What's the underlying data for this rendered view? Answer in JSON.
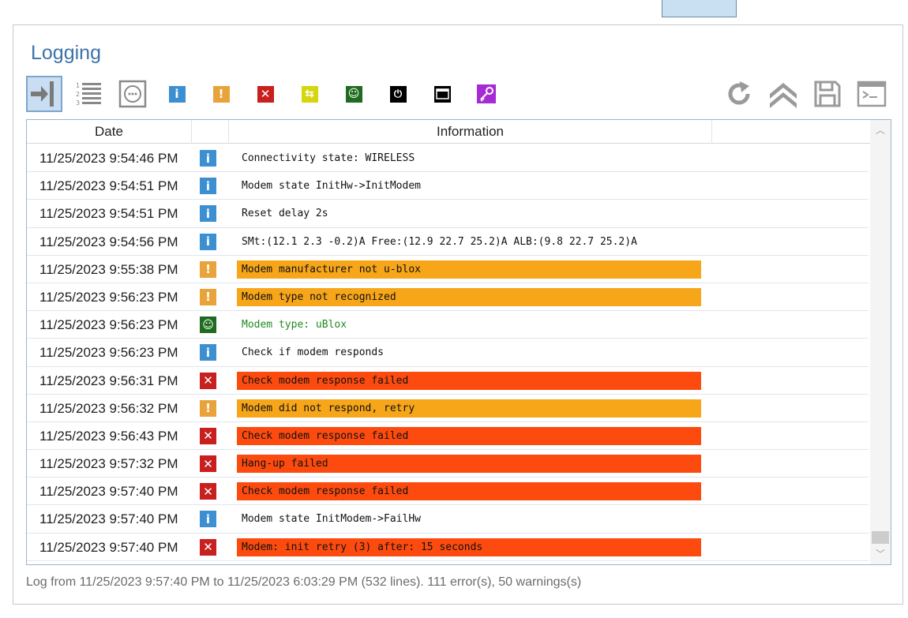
{
  "title": "Logging",
  "toolbar": {
    "left": [
      {
        "name": "follow-tail-button",
        "icon": "arrow-to-line-icon",
        "active": true
      },
      {
        "name": "line-numbers-button",
        "icon": "numbered-list-icon"
      },
      {
        "name": "filter-all-button",
        "icon": "circle-dots-icon"
      },
      {
        "name": "filter-info-button",
        "icon": "info-icon",
        "color": "#3c8fd0"
      },
      {
        "name": "filter-warning-button",
        "icon": "warning-icon",
        "color": "#e8a43a"
      },
      {
        "name": "filter-error-button",
        "icon": "error-icon",
        "color": "#c81f1f"
      },
      {
        "name": "filter-transfer-button",
        "icon": "exchange-icon",
        "color": "#d6d60e"
      },
      {
        "name": "filter-ok-button",
        "icon": "smiley-icon",
        "color": "#1f6b1f"
      },
      {
        "name": "filter-power-button",
        "icon": "power-icon",
        "color": "#000000"
      },
      {
        "name": "filter-terminal-button",
        "icon": "terminal-icon",
        "color": "#000000"
      },
      {
        "name": "filter-key-button",
        "icon": "key-icon",
        "color": "#a62bd6"
      }
    ],
    "right": [
      {
        "name": "refresh-button",
        "icon": "refresh-icon"
      },
      {
        "name": "scroll-top-button",
        "icon": "double-chevron-up-icon"
      },
      {
        "name": "save-button",
        "icon": "save-icon"
      },
      {
        "name": "console-button",
        "icon": "console-icon"
      }
    ]
  },
  "table": {
    "columns": [
      "Date",
      "Information"
    ],
    "rows": [
      {
        "date": "11/25/2023 9:54:46 PM",
        "type": "info",
        "message": "Connectivity state: WIRELESS"
      },
      {
        "date": "11/25/2023 9:54:51 PM",
        "type": "info",
        "message": "Modem state InitHw->InitModem"
      },
      {
        "date": "11/25/2023 9:54:51 PM",
        "type": "info",
        "message": "Reset delay 2s"
      },
      {
        "date": "11/25/2023 9:54:56 PM",
        "type": "info",
        "message": "SMt:(12.1 2.3 -0.2)A Free:(12.9 22.7 25.2)A ALB:(9.8 22.7 25.2)A"
      },
      {
        "date": "11/25/2023 9:55:38 PM",
        "type": "warning",
        "message": "Modem manufacturer not u-blox"
      },
      {
        "date": "11/25/2023 9:56:23 PM",
        "type": "warning",
        "message": "Modem type not recognized"
      },
      {
        "date": "11/25/2023 9:56:23 PM",
        "type": "ok",
        "message": "Modem type: uBlox"
      },
      {
        "date": "11/25/2023 9:56:23 PM",
        "type": "info",
        "message": "Check if modem responds"
      },
      {
        "date": "11/25/2023 9:56:31 PM",
        "type": "error",
        "message": "Check modem response failed"
      },
      {
        "date": "11/25/2023 9:56:32 PM",
        "type": "warning",
        "message": "Modem did not respond, retry"
      },
      {
        "date": "11/25/2023 9:56:43 PM",
        "type": "error",
        "message": "Check modem response failed"
      },
      {
        "date": "11/25/2023 9:57:32 PM",
        "type": "error",
        "message": "Hang-up failed"
      },
      {
        "date": "11/25/2023 9:57:40 PM",
        "type": "error",
        "message": "Check modem response failed"
      },
      {
        "date": "11/25/2023 9:57:40 PM",
        "type": "info",
        "message": "Modem state InitModem->FailHw"
      },
      {
        "date": "11/25/2023 9:57:40 PM",
        "type": "error",
        "message": "Modem: init retry (3) after: 15 seconds"
      }
    ]
  },
  "footer": "Log from 11/25/2023 9:57:40 PM to 11/25/2023 6:03:29 PM (532 lines). 111 error(s), 50 warnings(s)",
  "colors": {
    "info": "#3c8fd0",
    "warning": "#e8a43a",
    "error": "#c81f1f",
    "ok": "#1f6b1f",
    "warning_bg": "#f7a61a",
    "error_bg": "#fd4b0f",
    "title": "#3d73a8"
  }
}
